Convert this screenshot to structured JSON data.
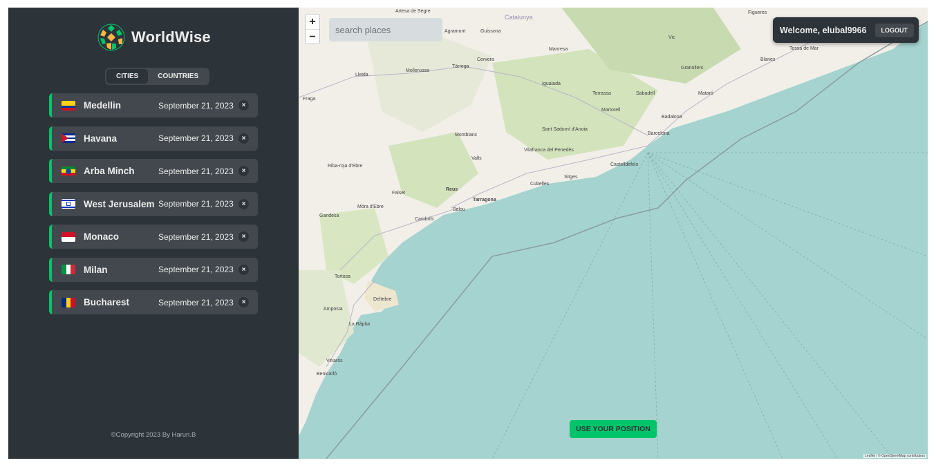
{
  "brand": {
    "name": "WorldWise"
  },
  "tabs": [
    {
      "label": "CITIES"
    },
    {
      "label": "COUNTRIES"
    }
  ],
  "cities": [
    {
      "name": "Medellin",
      "date": "September 21, 2023",
      "flag": "colombia"
    },
    {
      "name": "Havana",
      "date": "September 21, 2023",
      "flag": "cuba"
    },
    {
      "name": "Arba Minch",
      "date": "September 21, 2023",
      "flag": "ethiopia"
    },
    {
      "name": "West Jerusalem",
      "date": "September 21, 2023",
      "flag": "israel"
    },
    {
      "name": "Monaco",
      "date": "September 21, 2023",
      "flag": "monaco"
    },
    {
      "name": "Milan",
      "date": "September 21, 2023",
      "flag": "italy"
    },
    {
      "name": "Bucharest",
      "date": "September 21, 2023",
      "flag": "romania"
    }
  ],
  "delete_symbol": "×",
  "footer": {
    "copyright": "©Copyright  2023  By Harun.B"
  },
  "map": {
    "search_placeholder": "search places",
    "zoom_in": "+",
    "zoom_out": "−",
    "user_greeting": "Welcome, elubal9966",
    "logout_label": "LOGOUT",
    "use_position_label": "USE YOUR POSITION",
    "attribution": "Leaflet | © OpenStreetMap contributors",
    "places": [
      "Catalunya",
      "Artesa de Segre",
      "Agramunt",
      "Guissona",
      "Lleida",
      "Mollerussa",
      "Tàrrega",
      "Cervera",
      "Igualada",
      "Manresa",
      "Vic",
      "Terrassa",
      "Sabadell",
      "Badalona",
      "Barcelona",
      "Mataró",
      "Granollers",
      "Martorell",
      "Sant Sadurní d'Anoia",
      "Vilafranca del Penedès",
      "Castelldefels",
      "Sitges",
      "Cubelles",
      "Valls",
      "Montblanc",
      "Reus",
      "Tarragona",
      "Salou",
      "Cambrils",
      "Falset",
      "Móra d'Ebre",
      "Gandesa",
      "Tortosa",
      "Deltebre",
      "Amposta",
      "La Ràpita",
      "Vinaròs",
      "Benicarló",
      "Fraga",
      "Riba-roja d'Ebre",
      "Tossa de Mar",
      "Blanes",
      "Figueres"
    ]
  },
  "colors": {
    "sidebar_bg": "#2d3439",
    "item_bg": "#42484d",
    "accent": "#00c46a",
    "text": "#ececec",
    "sea": "#a5d3cf",
    "land": "#f2efe9"
  }
}
